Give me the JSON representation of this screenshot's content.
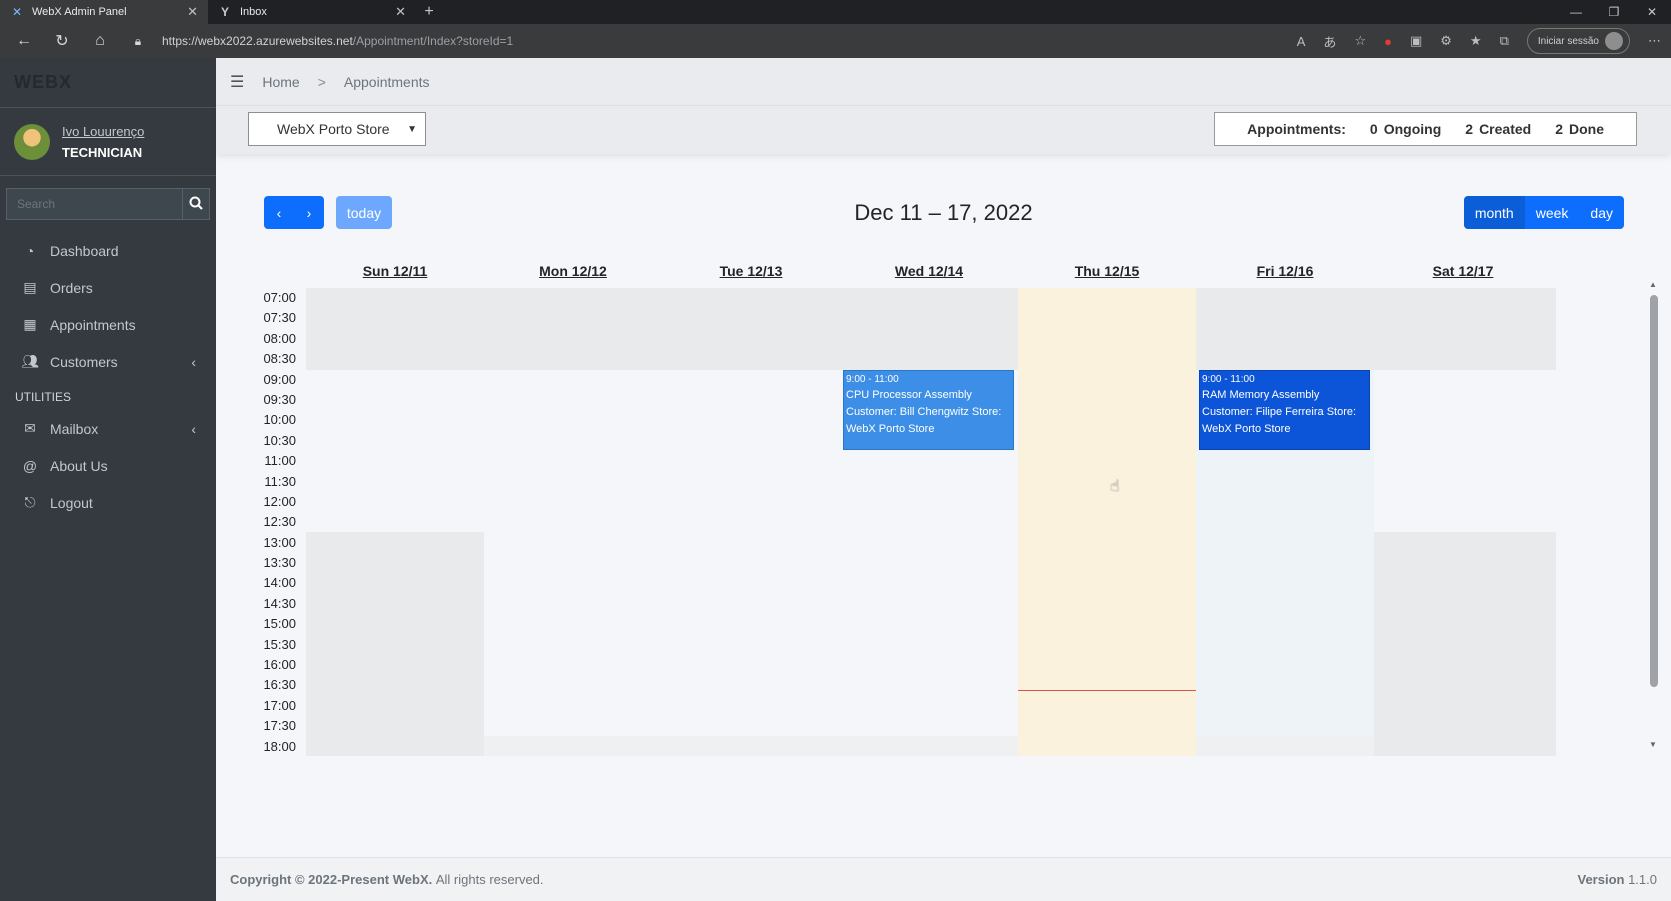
{
  "browser": {
    "tabs": [
      {
        "title": "WebX Admin Panel",
        "active": true
      },
      {
        "title": "Inbox",
        "active": false
      }
    ],
    "url_host": "https://webx2022.azurewebsites.net",
    "url_path": "/Appointment/Index?storeId=1",
    "signin_label": "Iniciar sessão"
  },
  "sidebar": {
    "brand": "WEBX",
    "user_name": "Ivo Louurenço",
    "user_role": "TECHNICIAN",
    "search_placeholder": "Search",
    "items": [
      {
        "label": "Dashboard",
        "icon": "dashboard-icon"
      },
      {
        "label": "Orders",
        "icon": "orders-icon"
      },
      {
        "label": "Appointments",
        "icon": "calendar-icon"
      },
      {
        "label": "Customers",
        "icon": "users-icon",
        "chevron": true
      }
    ],
    "utilities_header": "UTILITIES",
    "util_items": [
      {
        "label": "Mailbox",
        "icon": "mail-icon",
        "chevron": true
      },
      {
        "label": "About Us",
        "icon": "at-icon"
      },
      {
        "label": "Logout",
        "icon": "logout-icon"
      }
    ]
  },
  "breadcrumb": {
    "home": "Home",
    "sep": ">",
    "current": "Appointments"
  },
  "store_select": {
    "value": "WebX Porto Store"
  },
  "stats": {
    "label": "Appointments:",
    "ongoing_count": "0",
    "ongoing_label": "Ongoing",
    "created_count": "2",
    "created_label": "Created",
    "done_count": "2",
    "done_label": "Done"
  },
  "calendar": {
    "today_label": "today",
    "title": "Dec 11 – 17, 2022",
    "views": [
      "month",
      "week",
      "day"
    ],
    "days": [
      "Sun 12/11",
      "Mon 12/12",
      "Tue 12/13",
      "Wed 12/14",
      "Thu 12/15",
      "Fri 12/16",
      "Sat 12/17"
    ],
    "times": [
      "07:00",
      "07:30",
      "08:00",
      "08:30",
      "09:00",
      "09:30",
      "10:00",
      "10:30",
      "11:00",
      "11:30",
      "12:00",
      "12:30",
      "13:00",
      "13:30",
      "14:00",
      "14:30",
      "15:00",
      "15:30",
      "16:00",
      "16:30",
      "17:00",
      "17:30",
      "18:00"
    ],
    "events": [
      {
        "time": "9:00 - 11:00",
        "title": "CPU Processor Assembly",
        "detail": "Customer: Bill Chengwitz Store: WebX Porto Store",
        "color": "#3d8ee6"
      },
      {
        "time": "9:00 - 11:00",
        "title": "RAM Memory Assembly",
        "detail": "Customer: Filipe Ferreira Store: WebX Porto Store",
        "color": "#0d55d8"
      }
    ]
  },
  "footer": {
    "copyright": "Copyright © 2022-Present WebX.",
    "rights": "All rights reserved.",
    "version_label": "Version",
    "version": "1.1.0"
  }
}
